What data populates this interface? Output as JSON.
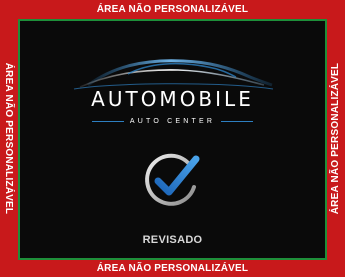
{
  "border": {
    "top_label": "ÁREA NÃO PERSONALIZÁVEL",
    "bottom_label": "ÁREA NÃO PERSONALIZÁVEL",
    "left_label": "ÁREA NÃO PERSONALIZÁVEL",
    "right_label": "ÁREA NÃO PERSONALIZÁVEL",
    "color": "#c8191b",
    "safe_line_color": "#1e8f3a"
  },
  "logo": {
    "brand": "AUTOMOBILE",
    "tagline": "AUTO CENTER",
    "accent_color": "#2d7fc1",
    "icon": "car-silhouette-icon"
  },
  "badge": {
    "icon": "checkmark-circle-icon",
    "label": "REVISADO"
  }
}
